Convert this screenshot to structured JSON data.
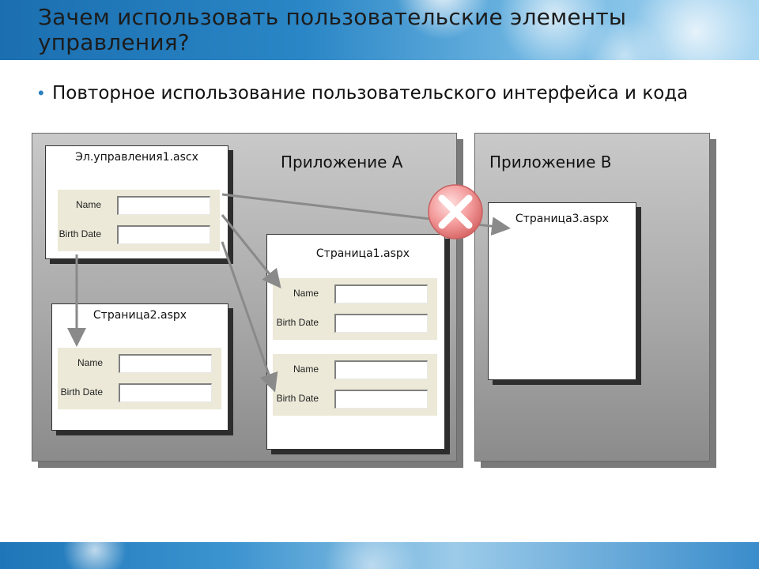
{
  "slide": {
    "title": "Зачем использовать пользовательские элементы управления?",
    "bullet": "Повторное использование пользовательского интерфейса и кода"
  },
  "panels": {
    "app_a_label": "Приложение А",
    "app_b_label": "Приложение В"
  },
  "cards": {
    "control": "Эл.управления1.ascx",
    "page1": "Страница1.aspx",
    "page2": "Страница2.aspx",
    "page3": "Страница3.aspx"
  },
  "form_labels": {
    "name": "Name",
    "birth_date": "Birth Date"
  },
  "colors": {
    "accent": "#2a7fbf",
    "panel_gray": "#a9a9a9",
    "form_bg": "#ece9d8",
    "arrow": "#8a8a8a",
    "forbidden_badge": "#f2a0a0"
  },
  "icons": {
    "forbidden": "x-circle-icon",
    "bullet": "bullet-dot-icon"
  }
}
